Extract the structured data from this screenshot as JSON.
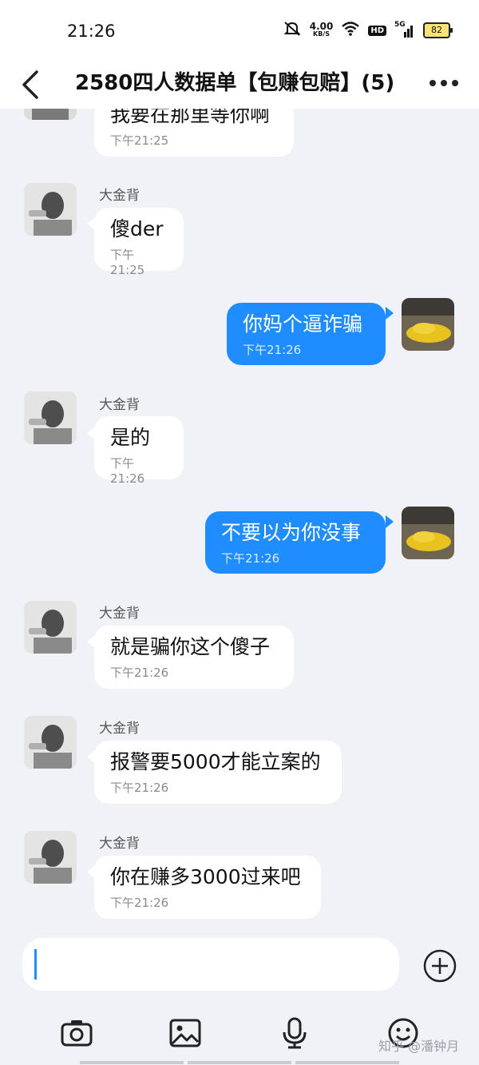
{
  "status_bar": {
    "time": "21:26",
    "speed_value": "4.00",
    "speed_unit": "KB/S",
    "hd": "HD",
    "network": "5G",
    "battery": "82"
  },
  "header": {
    "title": "2580四人数据单【包赚包赔】(5)"
  },
  "messages": [
    {
      "direction": "in",
      "sender": "",
      "text": "我要在那里等你啊",
      "time": "下午21:25"
    },
    {
      "direction": "in",
      "sender": "大金背",
      "text": "傻der",
      "time": "下午21:25"
    },
    {
      "direction": "out",
      "sender": "",
      "text": "你妈个逼诈骗",
      "time": "下午21:26"
    },
    {
      "direction": "in",
      "sender": "大金背",
      "text": "是的",
      "time": "下午21:26"
    },
    {
      "direction": "out",
      "sender": "",
      "text": "不要以为你没事",
      "time": "下午21:26"
    },
    {
      "direction": "in",
      "sender": "大金背",
      "text": "就是骗你这个傻子",
      "time": "下午21:26"
    },
    {
      "direction": "in",
      "sender": "大金背",
      "text": "报警要5000才能立案的",
      "time": "下午21:26"
    },
    {
      "direction": "in",
      "sender": "大金背",
      "text": "你在赚多3000过来吧",
      "time": "下午21:26"
    }
  ],
  "input": {
    "value": ""
  },
  "toolbar": {
    "icons": [
      "camera-icon",
      "image-icon",
      "microphone-icon",
      "emoji-icon"
    ]
  },
  "watermark": "知乎 @潘钟月",
  "colors": {
    "accent": "#1f8cff",
    "background": "#f1f2f7",
    "incoming_bubble": "#ffffff"
  }
}
